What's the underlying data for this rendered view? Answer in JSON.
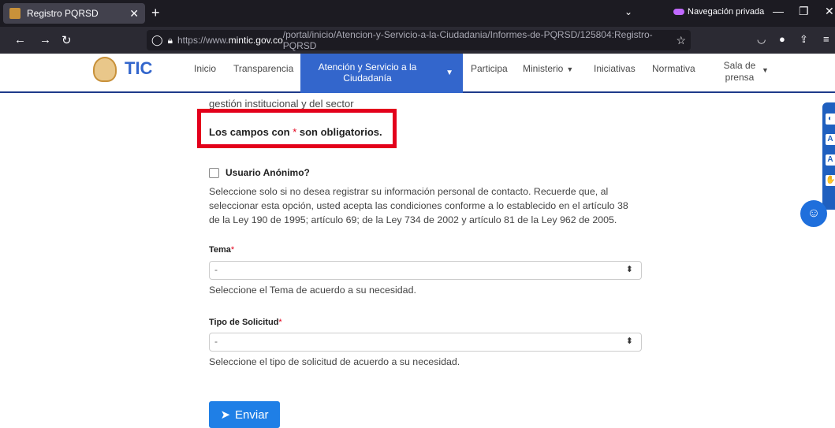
{
  "browser": {
    "tab_title": "Registro PQRSD",
    "tab_close": "✕",
    "new_tab": "+",
    "tabs_list": "⌄",
    "private_label": "Navegación privada",
    "url_prefix": "https://www.",
    "url_domain": "mintic.gov.co",
    "url_path": "/portal/inicio/Atencion-y-Servicio-a-la-Ciudadania/Informes-de-PQRSD/125804:Registro-PQRSD"
  },
  "header": {
    "logo_text": "TIC",
    "menu": {
      "inicio": "Inicio",
      "transparencia": "Transparencia",
      "atencion": "Atención y Servicio a la Ciudadanía",
      "participa": "Participa",
      "ministerio": "Ministerio",
      "iniciativas": "Iniciativas",
      "normativa": "Normativa",
      "sala_prensa": "Sala de prensa"
    }
  },
  "form": {
    "cut_text": "gestión institucional y del sector",
    "required_prefix": "Los campos con",
    "required_asterisk": "*",
    "required_suffix": "son obligatorios.",
    "anon_label": "Usuario Anónimo?",
    "anon_desc": "Seleccione solo si no desea registrar su información personal de contacto. Recuerde que, al seleccionar esta opción, usted acepta las condiciones conforme a lo establecido en el artículo 38 de la Ley 190 de 1995; artículo 69; de la Ley 734 de 2002 y artículo 81 de la Ley 962 de 2005.",
    "tema_label": "Tema",
    "tema_value": "-",
    "tema_help": "Seleccione el Tema de acuerdo a su necesidad.",
    "tipo_label": "Tipo de Solicitud",
    "tipo_value": "-",
    "tipo_help": "Seleccione el tipo de solicitud de acuerdo a su necesidad.",
    "submit_label": "Enviar"
  },
  "colors": {
    "accent": "#3366cc",
    "required_border": "#e3001b",
    "button": "#1f7fe6"
  }
}
